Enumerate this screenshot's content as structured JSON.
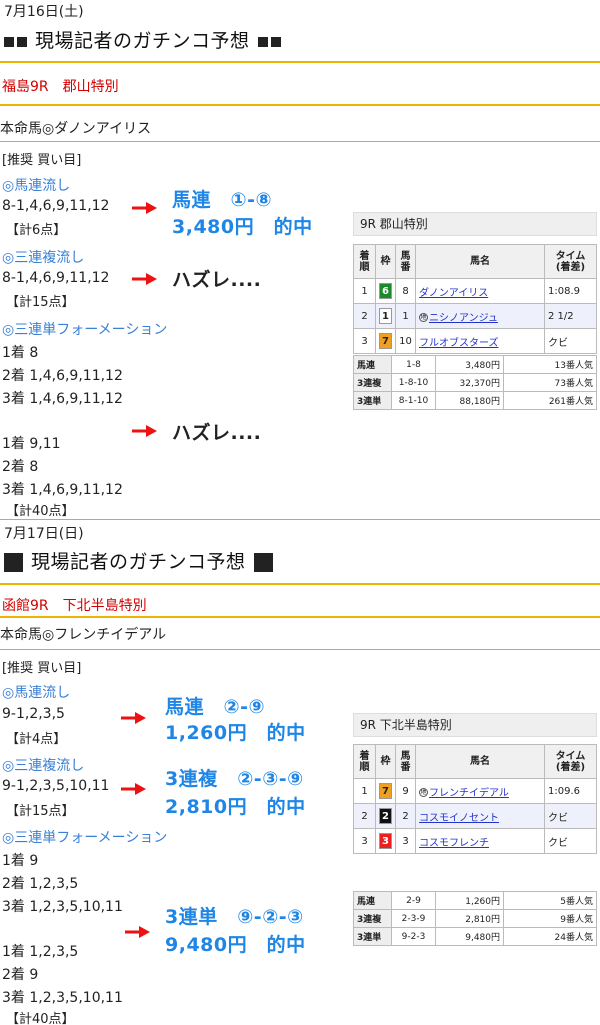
{
  "colors": {
    "race_red": "#d20000",
    "hit_blue": "#1f86e6",
    "link_blue": "#3a80d5",
    "divider_gold": "#f0b400",
    "arrow_red": "#ee1111"
  },
  "sec1": {
    "date": "7月16日(土)",
    "heading": "現場記者のガチンコ予想",
    "race": "福島9R　郡山特別",
    "honmei": "本命馬◎ダノンアイリス",
    "suisen": "[推奨 買い目]",
    "b1_title": "◎馬連流し",
    "b1_combo": "8-1,4,6,9,11,12",
    "b1_count": "【計6点】",
    "b1_res1": "馬連　①-⑧",
    "b1_res2": "3,480円　的中",
    "b2_title": "◎三連複流し",
    "b2_combo": "8-1,4,6,9,11,12",
    "b2_count": "【計15点】",
    "b2_res": "ハズレ....",
    "b3_title": "◎三連単フォーメーション",
    "b3_l1": "1着 8",
    "b3_l2": "2着 1,4,6,9,11,12",
    "b3_l3": "3着 1,4,6,9,11,12",
    "b3_l4": "1着 9,11",
    "b3_l5": "2着 8",
    "b3_l6": "3着 1,4,6,9,11,12",
    "b3_count": "【計40点】",
    "b3_res": "ハズレ....",
    "result": {
      "title": "9R 郡山特別",
      "headers": [
        "着順",
        "枠",
        "馬番",
        "馬名",
        "タイム\n(着差)"
      ],
      "rows": [
        {
          "pos": "1",
          "waku": "6",
          "num": "8",
          "name": "ダノンアイリス",
          "time": "1:08.9",
          "mark": ""
        },
        {
          "pos": "2",
          "waku": "1",
          "num": "1",
          "name": "ニシノアンジュ",
          "time": "2 1/2",
          "mark": "地"
        },
        {
          "pos": "3",
          "waku": "7",
          "num": "10",
          "name": "フルオブスターズ",
          "time": "クビ",
          "mark": ""
        }
      ],
      "pay": [
        {
          "kind": "馬連",
          "combo": "1-8",
          "yen": "3,480円",
          "pop": "13番人気"
        },
        {
          "kind": "3連複",
          "combo": "1-8-10",
          "yen": "32,370円",
          "pop": "73番人気"
        },
        {
          "kind": "3連単",
          "combo": "8-1-10",
          "yen": "88,180円",
          "pop": "261番人気"
        }
      ]
    }
  },
  "sec2": {
    "date": "7月17日(日)",
    "heading": "現場記者のガチンコ予想",
    "race": "函館9R　下北半島特別",
    "honmei": "本命馬◎フレンチイデアル",
    "suisen": "[推奨 買い目]",
    "b1_title": "◎馬連流し",
    "b1_combo": "9-1,2,3,5",
    "b1_count": "【計4点】",
    "b1_res1": "馬連　②-⑨",
    "b1_res2": "1,260円　的中",
    "b2_title": "◎三連複流し",
    "b2_combo": "9-1,2,3,5,10,11",
    "b2_count": "【計15点】",
    "b2_res1": "3連複　②-③-⑨",
    "b2_res2": "2,810円　的中",
    "b3_title": "◎三連単フォーメーション",
    "b3_l1": "1着 9",
    "b3_l2": "2着 1,2,3,5",
    "b3_l3": "3着 1,2,3,5,10,11",
    "b3_l4": "1着 1,2,3,5",
    "b3_l5": "2着 9",
    "b3_l6": "3着 1,2,3,5,10,11",
    "b3_count": "【計40点】",
    "b3_res1": "3連単　⑨-②-③",
    "b3_res2": "9,480円　的中",
    "result": {
      "title": "9R 下北半島特別",
      "headers": [
        "着順",
        "枠",
        "馬番",
        "馬名",
        "タイム\n(着差)"
      ],
      "rows": [
        {
          "pos": "1",
          "waku": "7",
          "num": "9",
          "name": "フレンチイデアル",
          "time": "1:09.6",
          "mark": "地"
        },
        {
          "pos": "2",
          "waku": "2",
          "num": "2",
          "name": "コスモイノセント",
          "time": "クビ",
          "mark": ""
        },
        {
          "pos": "3",
          "waku": "3",
          "num": "3",
          "name": "コスモフレンチ",
          "time": "クビ",
          "mark": ""
        }
      ],
      "pay": [
        {
          "kind": "馬連",
          "combo": "2-9",
          "yen": "1,260円",
          "pop": "5番人気"
        },
        {
          "kind": "3連複",
          "combo": "2-3-9",
          "yen": "2,810円",
          "pop": "9番人気"
        },
        {
          "kind": "3連単",
          "combo": "9-2-3",
          "yen": "9,480円",
          "pop": "24番人気"
        }
      ]
    }
  }
}
